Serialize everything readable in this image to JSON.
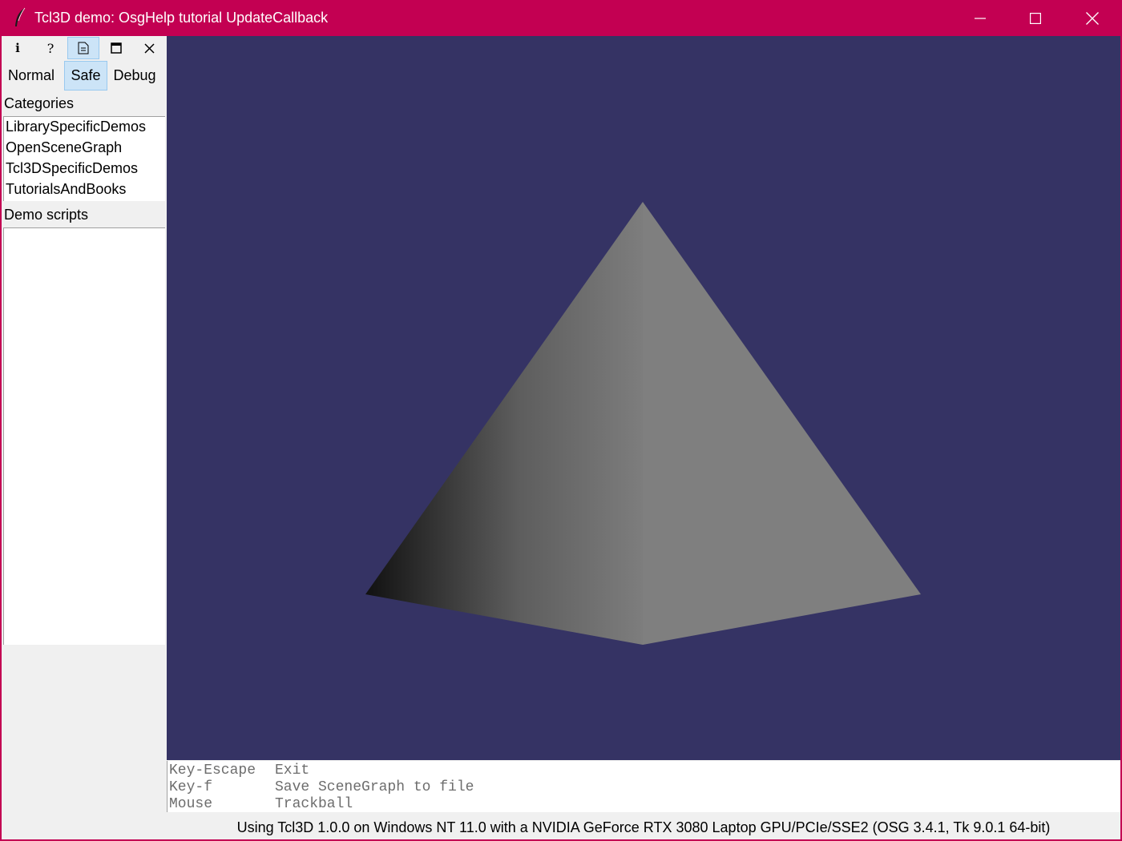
{
  "window": {
    "title": "Tcl3D demo: OsgHelp tutorial UpdateCallback",
    "icon": "feather-icon",
    "colors": {
      "titlebar": "#c30052",
      "viewport": "#353364",
      "panel": "#f0f0f0",
      "active": "#cce4f7"
    }
  },
  "toolbar": {
    "info_glyph": "i",
    "help_glyph": "?",
    "buttons": [
      "info-icon",
      "help-icon",
      "document-icon",
      "window-icon",
      "close-icon"
    ],
    "active": "document-icon"
  },
  "modes": {
    "items": [
      "Normal",
      "Safe",
      "Debug"
    ],
    "selected": "Safe"
  },
  "categories": {
    "label": "Categories",
    "items": [
      "LibrarySpecificDemos",
      "OpenSceneGraph",
      "Tcl3DSpecificDemos",
      "TutorialsAndBooks"
    ]
  },
  "demo_scripts": {
    "label": "Demo scripts",
    "items": []
  },
  "info": {
    "lines": [
      {
        "key": "Key-Escape",
        "desc": "Exit"
      },
      {
        "key": "Key-f",
        "desc": "Save SceneGraph to file"
      },
      {
        "key": "Mouse",
        "desc": "Trackball"
      }
    ]
  },
  "status": {
    "text": "Using Tcl3D 1.0.0 on Windows NT 11.0 with a NVIDIA GeForce RTX 3080 Laptop GPU/PCIe/SSE2 (OSG 3.4.1, Tk 9.0.1 64-bit)"
  }
}
